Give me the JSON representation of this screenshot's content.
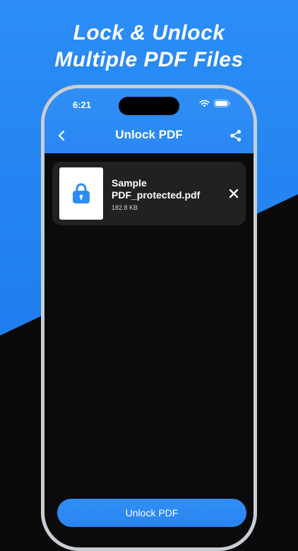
{
  "headline": {
    "line1": "Lock & Unlock",
    "line2": "Multiple PDF Files"
  },
  "status_bar": {
    "time": "6:21",
    "icons": [
      "wifi-icon",
      "battery-icon"
    ]
  },
  "nav": {
    "title": "Unlock PDF",
    "back_icon": "chevron-left-icon",
    "share_icon": "share-icon"
  },
  "files": [
    {
      "name": "Sample PDF_protected.pdf",
      "size": "182.8 KB",
      "thumbnail_icon": "lock-icon",
      "remove_icon": "close-icon"
    }
  ],
  "primary_action": {
    "label": "Unlock PDF"
  },
  "colors": {
    "accent": "#2b8df5",
    "background_dark": "#0a0a0a",
    "card": "#1f2123"
  }
}
